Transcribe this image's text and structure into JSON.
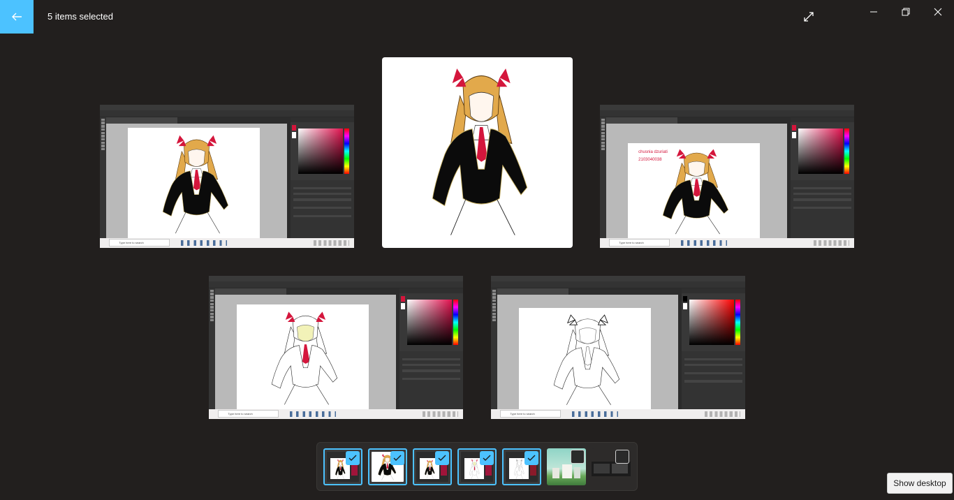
{
  "header": {
    "title": "5 items selected",
    "back_icon": "arrow-left-icon",
    "expand_icon": "expand-icon",
    "minimize_icon": "minimize-icon",
    "restore_icon": "restore-icon",
    "close_icon": "close-icon"
  },
  "colors": {
    "accent": "#4cc2ff",
    "background": "#221f1e",
    "ribbon": "#d4163c",
    "hair": "#e2a94b"
  },
  "tiles": [
    {
      "kind": "photoshop-screenshot",
      "search_text": "Type here to search"
    },
    {
      "kind": "artwork"
    },
    {
      "kind": "photoshop-screenshot",
      "search_text": "Type here to search",
      "canvas_text_line1": "chusnia dzuriati",
      "canvas_text_line2": "2103040038"
    },
    {
      "kind": "photoshop-screenshot",
      "search_text": "Type here to search"
    },
    {
      "kind": "photoshop-screenshot",
      "search_text": "Type here to search"
    }
  ],
  "filmstrip": {
    "thumbs": [
      {
        "selected": true
      },
      {
        "selected": true
      },
      {
        "selected": true
      },
      {
        "selected": true
      },
      {
        "selected": true
      },
      {
        "selected": false
      },
      {
        "selected": false
      }
    ]
  },
  "tooltip": {
    "text": "Show desktop"
  }
}
